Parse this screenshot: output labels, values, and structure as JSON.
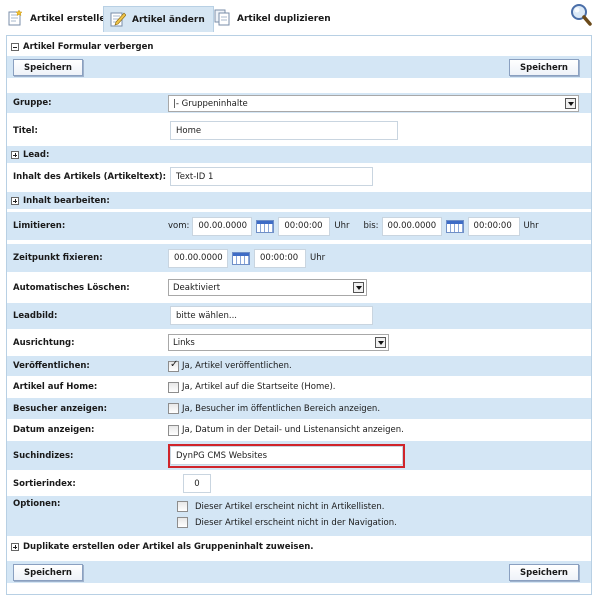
{
  "tabs": {
    "create": "Artikel erstellen",
    "edit": "Artikel ändern",
    "duplicate": "Artikel duplizieren"
  },
  "form_toggle": "Artikel Formular verbergen",
  "save_label": "Speichern",
  "fields": {
    "gruppe": {
      "label": "Gruppe:",
      "value": "|- Gruppeninhalte"
    },
    "titel": {
      "label": "Titel:",
      "value": "Home"
    },
    "lead": {
      "label": "Lead:"
    },
    "inhalt": {
      "label": "Inhalt des Artikels (Artikeltext):",
      "value": "Text-ID 1"
    },
    "inhalt_bearbeiten": {
      "label": "Inhalt bearbeiten:"
    },
    "limitieren": {
      "label": "Limitieren:",
      "von_label": "vom:",
      "von_date": "00.00.0000",
      "von_time": "00:00:00",
      "uhr": "Uhr",
      "bis_label": "bis:",
      "bis_date": "00.00.0000",
      "bis_time": "00:00:00"
    },
    "zeitpunkt": {
      "label": "Zeitpunkt fixieren:",
      "date": "00.00.0000",
      "time": "00:00:00",
      "uhr": "Uhr"
    },
    "loeschen": {
      "label": "Automatisches Löschen:",
      "value": "Deaktiviert"
    },
    "leadbild": {
      "label": "Leadbild:",
      "value": "bitte wählen..."
    },
    "ausrichtung": {
      "label": "Ausrichtung:",
      "value": "Links"
    },
    "veroeffentlichen": {
      "label": "Veröffentlichen:",
      "text": "Ja, Artikel veröffentlichen.",
      "checked": true
    },
    "home": {
      "label": "Artikel auf Home:",
      "text": "Ja, Artikel auf die Startseite (Home).",
      "checked": false
    },
    "besucher": {
      "label": "Besucher anzeigen:",
      "text": "Ja, Besucher im öffentlichen Bereich anzeigen.",
      "checked": false
    },
    "datum": {
      "label": "Datum anzeigen:",
      "text": "Ja, Datum in der Detail- und Listenansicht anzeigen.",
      "checked": false
    },
    "suchindizes": {
      "label": "Suchindizes:",
      "value": "DynPG CMS Websites"
    },
    "sortierindex": {
      "label": "Sortierindex:",
      "value": "0"
    },
    "optionen": {
      "label": "Optionen:",
      "opt1": "Dieser Artikel erscheint nicht in Artikellisten.",
      "opt2": "Dieser Artikel erscheint nicht in der Navigation."
    }
  },
  "duplicate_toggle": "Duplikate erstellen oder Artikel als Gruppeninhalt zuweisen.",
  "colors": {
    "row_blue": "#d4e6f5",
    "highlight": "#d0242a"
  }
}
